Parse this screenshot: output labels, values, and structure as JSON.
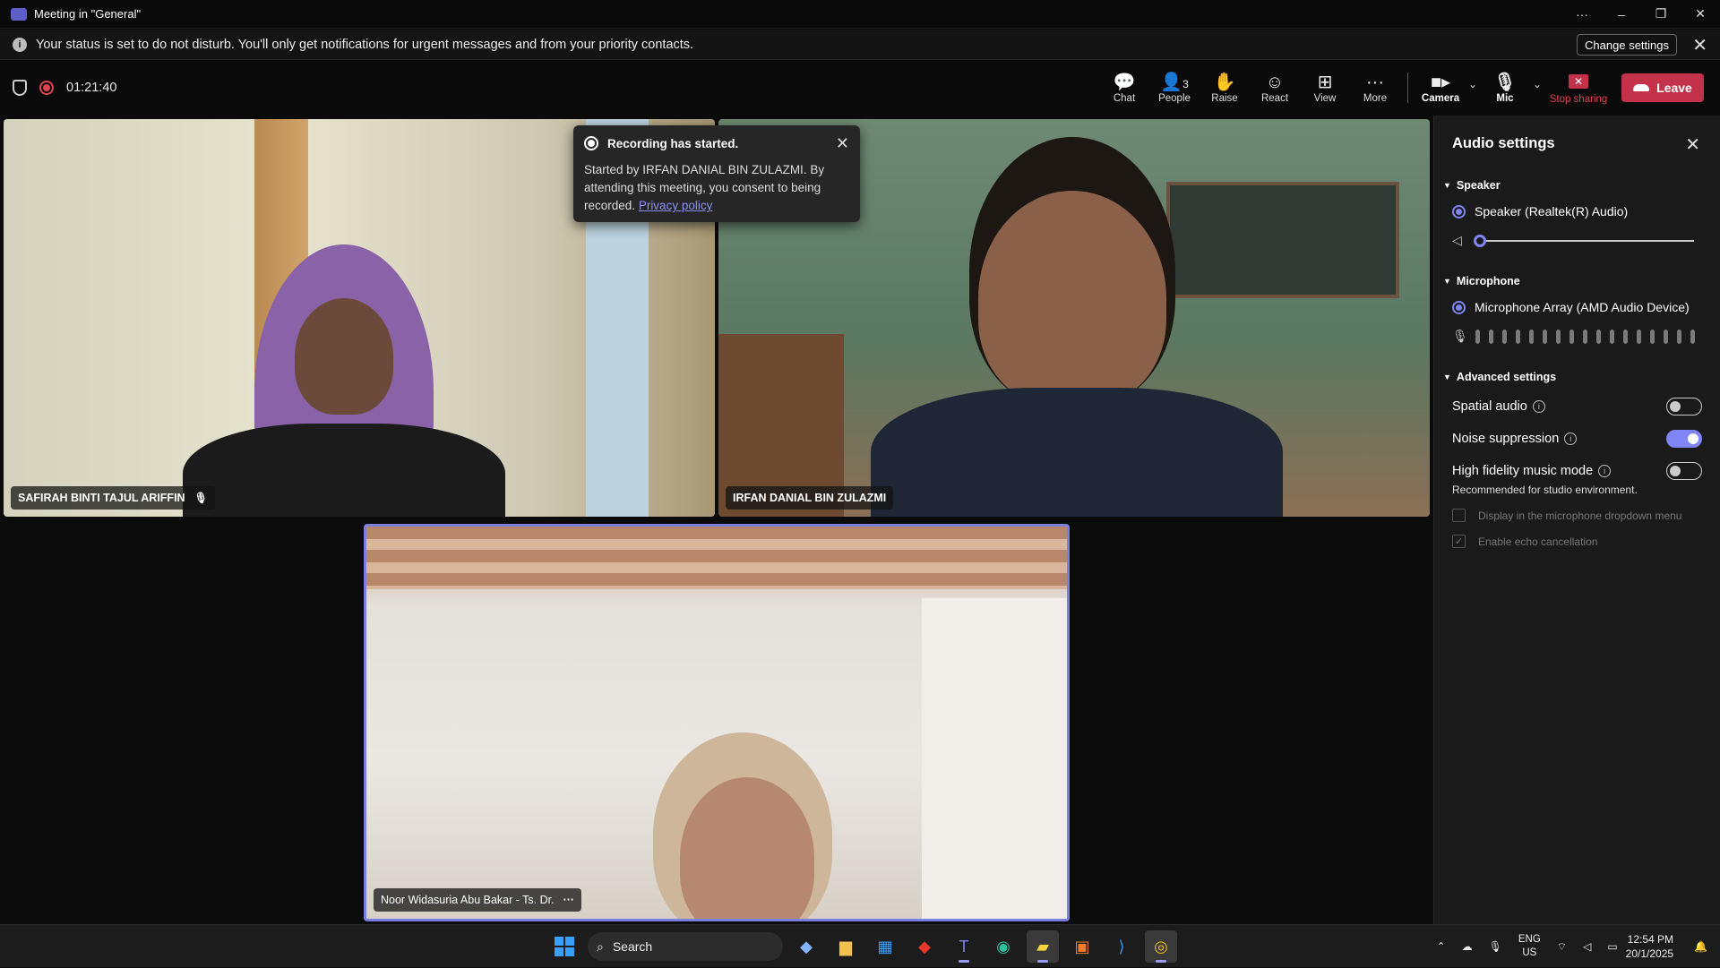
{
  "window": {
    "title": "Meeting in \"General\""
  },
  "dnd": {
    "message": "Your status is set to do not disturb. You'll only get notifications for urgent messages and from your priority contacts.",
    "change_label": "Change settings"
  },
  "meeting": {
    "timer": "01:21:40"
  },
  "toolbar": {
    "chat": "Chat",
    "people": "People",
    "people_count": "3",
    "raise": "Raise",
    "react": "React",
    "view": "View",
    "more": "More",
    "camera": "Camera",
    "mic": "Mic",
    "stop_sharing": "Stop sharing",
    "leave": "Leave"
  },
  "participants": [
    {
      "name": "SAFIRAH BINTI TAJUL ARIFFIN"
    },
    {
      "name": "IRFAN DANIAL BIN ZULAZMI"
    },
    {
      "name": "Noor Widasuria Abu Bakar - Ts. Dr."
    }
  ],
  "toast": {
    "title": "Recording has started.",
    "body": "Started by IRFAN DANIAL BIN ZULAZMI. By attending this meeting, you consent to being recorded.",
    "link": "Privacy policy"
  },
  "audio_settings": {
    "title": "Audio settings",
    "speaker_section": "Speaker",
    "speaker_device": "Speaker (Realtek(R) Audio)",
    "speaker_volume": 0,
    "microphone_section": "Microphone",
    "microphone_device": "Microphone Array (AMD Audio Device)",
    "advanced_section": "Advanced settings",
    "spatial_audio": "Spatial audio",
    "spatial_audio_on": false,
    "noise_suppression": "Noise suppression",
    "noise_suppression_on": true,
    "hifi_mode": "High fidelity music mode",
    "hifi_mode_on": false,
    "hifi_note": "Recommended for studio environment.",
    "display_in_dropdown": "Display in the microphone dropdown menu",
    "echo_cancellation": "Enable echo cancellation"
  },
  "taskbar": {
    "search": "Search",
    "lang": "ENG",
    "region": "US",
    "time": "12:54 PM",
    "date": "20/1/2025"
  }
}
